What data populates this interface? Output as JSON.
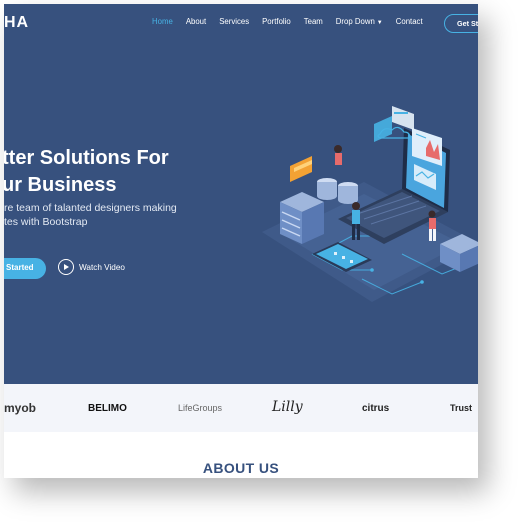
{
  "header": {
    "logo": "HA",
    "nav": [
      {
        "label": "Home",
        "active": true
      },
      {
        "label": "About",
        "active": false
      },
      {
        "label": "Services",
        "active": false
      },
      {
        "label": "Portfolio",
        "active": false
      },
      {
        "label": "Team",
        "active": false
      },
      {
        "label": "Drop Down",
        "active": false
      },
      {
        "label": "Contact",
        "active": false
      }
    ],
    "cta": "Get Sta"
  },
  "hero": {
    "title_line1": "tter Solutions For",
    "title_line2": "ur Business",
    "subtitle_line1": "re team of talanted designers making",
    "subtitle_line2": "tes with Bootstrap",
    "primary_button": "Started",
    "secondary_button": "Watch Video"
  },
  "clients": [
    "myob",
    "BELIMO",
    "LifeGroups",
    "Lilly",
    "citrus",
    "Trust"
  ],
  "about": {
    "heading": "ABOUT US"
  },
  "colors": {
    "hero_bg": "#37517e",
    "accent": "#47b2e4",
    "clients_bg": "#f3f5fa"
  },
  "icons": [
    "play-icon",
    "chevron-down-icon"
  ]
}
